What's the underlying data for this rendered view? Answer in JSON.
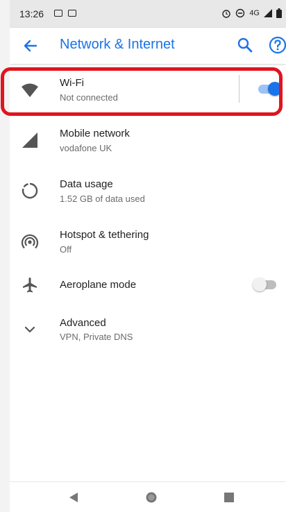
{
  "status_bar": {
    "time": "13:26",
    "network_label": "4G"
  },
  "app_bar": {
    "title": "Network & Internet",
    "accent_color": "#1a73e8"
  },
  "settings": [
    {
      "id": "wifi",
      "label": "Wi-Fi",
      "subtitle": "Not connected",
      "icon": "wifi-icon",
      "toggle": true,
      "toggle_on": true
    },
    {
      "id": "mobile",
      "label": "Mobile network",
      "subtitle": "vodafone UK",
      "icon": "signal-icon"
    },
    {
      "id": "data",
      "label": "Data usage",
      "subtitle": "1.52 GB of data used",
      "icon": "data-usage-icon"
    },
    {
      "id": "hotspot",
      "label": "Hotspot & tethering",
      "subtitle": "Off",
      "icon": "hotspot-icon"
    },
    {
      "id": "aeroplane",
      "label": "Aeroplane mode",
      "subtitle": "",
      "icon": "airplane-icon",
      "toggle": true,
      "toggle_on": false
    },
    {
      "id": "advanced",
      "label": "Advanced",
      "subtitle": "VPN, Private DNS",
      "icon": "chevron-down-icon"
    }
  ],
  "colors": {
    "toggle_on_thumb": "#1a73e8",
    "toggle_on_track": "#9ec2f5",
    "toggle_off_thumb": "#f1f1f1",
    "toggle_off_track": "#bdbdbd",
    "highlight": "#e0141e"
  }
}
